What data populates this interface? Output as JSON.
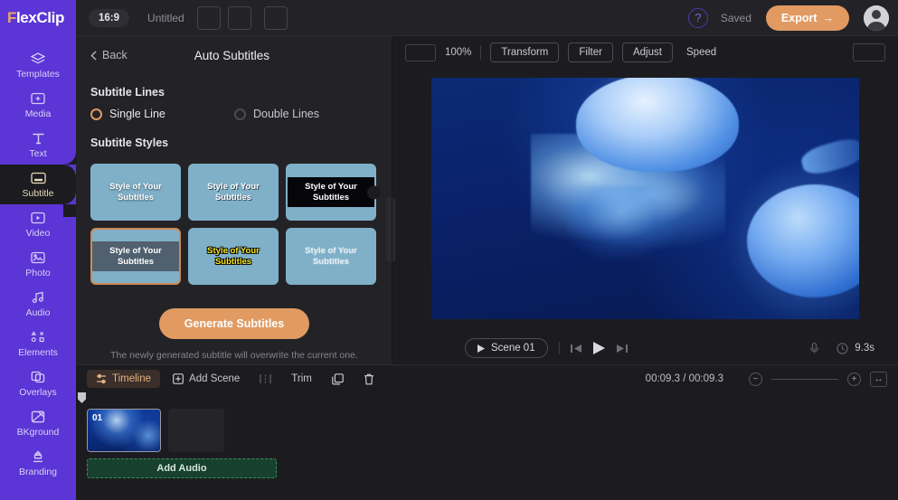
{
  "brand": {
    "prefix": "F",
    "rest": "lexClip"
  },
  "sidebar": {
    "items": [
      {
        "label": "Templates",
        "icon": "layers-icon"
      },
      {
        "label": "Media",
        "icon": "media-plus-icon"
      },
      {
        "label": "Text",
        "icon": "text-icon"
      },
      {
        "label": "Subtitle",
        "icon": "subtitle-icon"
      },
      {
        "label": "Video",
        "icon": "video-icon"
      },
      {
        "label": "Photo",
        "icon": "photo-icon"
      },
      {
        "label": "Audio",
        "icon": "audio-icon"
      },
      {
        "label": "Elements",
        "icon": "elements-icon"
      },
      {
        "label": "Overlays",
        "icon": "overlays-icon"
      },
      {
        "label": "BKground",
        "icon": "background-icon"
      },
      {
        "label": "Branding",
        "icon": "branding-icon"
      }
    ],
    "active_index": 3
  },
  "header": {
    "aspect_ratio": "16:9",
    "project_title": "Untitled",
    "help_icon": "question-mark-icon",
    "save_status": "Saved",
    "export_label": "Export",
    "export_arrow": "→",
    "export_color": "#e09a62"
  },
  "panel": {
    "back_label": "Back",
    "title": "Auto Subtitles",
    "lines_section_label": "Subtitle Lines",
    "line_options": [
      {
        "label": "Single Line",
        "selected": true
      },
      {
        "label": "Double Lines",
        "selected": false
      }
    ],
    "styles_section_label": "Subtitle Styles",
    "styles": [
      {
        "text": "Style of Your Subtitles",
        "selected": false
      },
      {
        "text": "Style of Your Subtitles",
        "selected": false
      },
      {
        "text": "Style of Your Subtitles",
        "selected": false
      },
      {
        "text": "Style of Your Subtitles",
        "selected": true
      },
      {
        "text": "Style of Your Subtitles",
        "selected": false
      },
      {
        "text": "Style of Your Subtitles",
        "selected": false
      }
    ],
    "generate_label": "Generate Subtitles",
    "generate_hint": "The newly generated subtitle will overwrite the current one.",
    "accent_color": "#e09a62"
  },
  "toolbar": {
    "zoom_value": "100%",
    "buttons": [
      {
        "label": "Transform",
        "bordered": true
      },
      {
        "label": "Filter",
        "bordered": true
      },
      {
        "label": "Adjust",
        "bordered": true
      },
      {
        "label": "Speed",
        "bordered": false
      }
    ]
  },
  "player": {
    "scene_label": "Scene 01",
    "prev_icon": "skip-previous-icon",
    "play_icon": "play-icon",
    "next_icon": "skip-next-icon",
    "volume_icon": "volume-icon",
    "clock_icon": "clock-icon",
    "duration": "9.3s"
  },
  "timeline": {
    "tab_label": "Timeline",
    "tab_icon": "timeline-icon",
    "add_scene_label": "Add Scene",
    "add_scene_icon": "plus-square-icon",
    "split_icon": "split-icon",
    "trim_label": "Trim",
    "copy_icon": "copy-icon",
    "delete_icon": "trash-icon",
    "time_readout": "00:09.3 / 00:09.3",
    "zoom_out_icon": "minus-circle-icon",
    "zoom_in_icon": "plus-circle-icon",
    "fit_icon": "fit-width-icon",
    "scenes": [
      {
        "number": "01"
      }
    ],
    "add_audio_label": "Add Audio"
  }
}
